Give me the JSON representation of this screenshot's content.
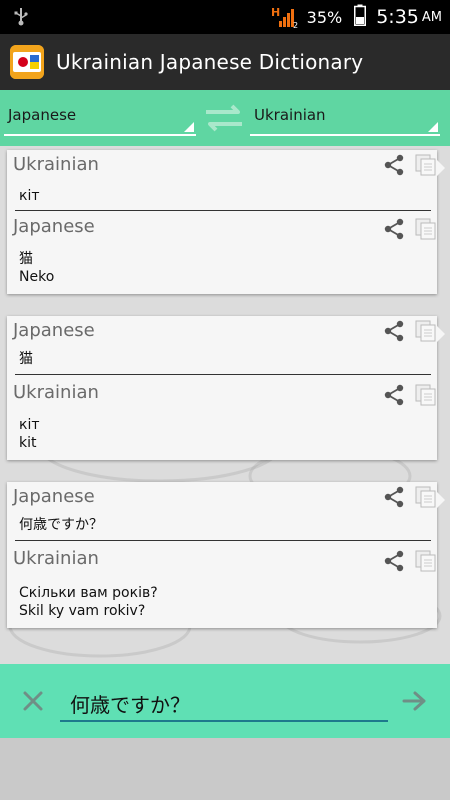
{
  "status_bar": {
    "signal_label": "H",
    "signal_sub": "2",
    "battery_pct": "35%",
    "time": "5:35",
    "ampm": "AM"
  },
  "action_bar": {
    "title": "Ukrainian Japanese Dictionary"
  },
  "language_bar": {
    "source": "Japanese",
    "target": "Ukrainian"
  },
  "cards": [
    {
      "top_lang": "Ukrainian",
      "top_text": "кіт",
      "bottom_lang": "Japanese",
      "bottom_line1": "猫",
      "bottom_line2": "Neko"
    },
    {
      "top_lang": "Japanese",
      "top_text": "猫",
      "bottom_lang": "Ukrainian",
      "bottom_line1": "кіт",
      "bottom_line2": "kit"
    },
    {
      "top_lang": "Japanese",
      "top_text": "何歳ですか？",
      "bottom_lang": "Ukrainian",
      "bottom_line1": "Скільки вам років?",
      "bottom_line2": "Skil ky vam rokiv?"
    }
  ],
  "input": {
    "value": "何歳ですか？"
  },
  "icons": {
    "share": "share-icon",
    "copy": "copy-icon",
    "clear": "close-icon",
    "send": "arrow-right-icon",
    "swap": "swap-icon"
  },
  "colors": {
    "accent_green": "#5fd6a2",
    "input_bar": "#5fe0b4",
    "action_bar": "#2a2a2a"
  }
}
